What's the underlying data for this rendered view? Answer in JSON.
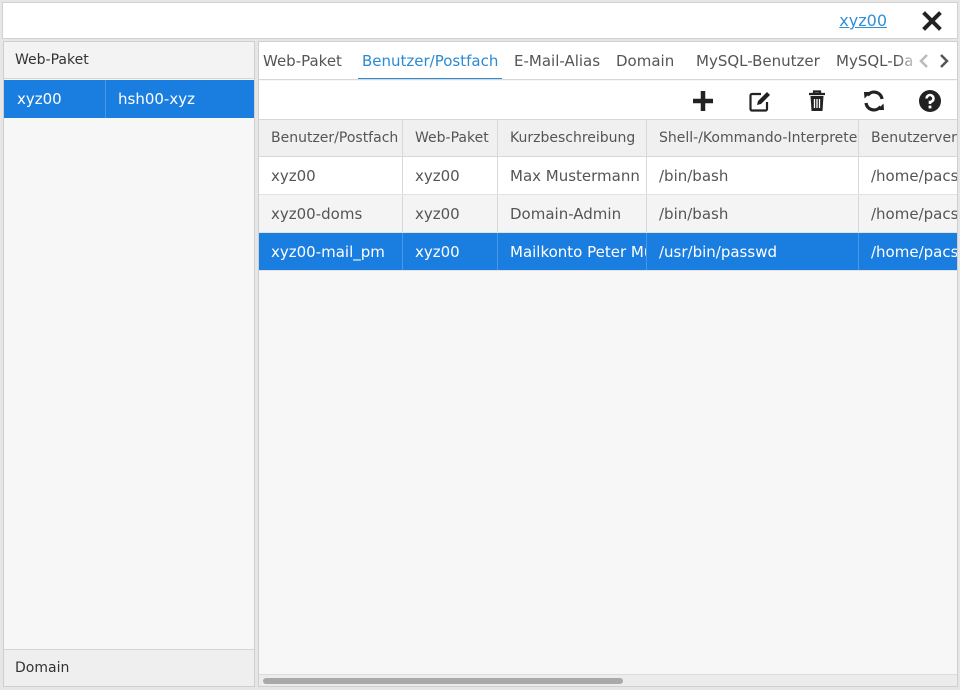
{
  "topbar": {
    "user_link": "xyz00",
    "close_icon": "close-icon"
  },
  "left_panel": {
    "header": "Web-Paket",
    "rows": [
      {
        "col1": "xyz00",
        "col2": "hsh00-xyz",
        "selected": true
      }
    ],
    "footer": "Domain"
  },
  "tabs": [
    {
      "label": "Web-Paket",
      "active": false
    },
    {
      "label": "Benutzer/Postfach",
      "active": true
    },
    {
      "label": "E-Mail-Alias",
      "active": false
    },
    {
      "label": "Domain",
      "active": false
    },
    {
      "label": "MySQL-Benutzer",
      "active": false
    },
    {
      "label": "MySQL-Da",
      "active": false
    }
  ],
  "tab_nav": {
    "prev_icon": "chevron-left-icon",
    "next_icon": "chevron-right-icon"
  },
  "toolbar": {
    "icons": [
      "plus-icon",
      "edit-icon",
      "trash-icon",
      "refresh-icon",
      "help-icon"
    ]
  },
  "grid": {
    "columns": [
      "Benutzer/Postfach",
      "Web-Paket",
      "Kurzbeschreibung",
      "Shell-/Kommando-Interpreter",
      "Benutzerverze"
    ],
    "rows": [
      {
        "cells": [
          "xyz00",
          "xyz00",
          "Max Mustermann",
          "/bin/bash",
          "/home/pacs/"
        ],
        "selected": false
      },
      {
        "cells": [
          "xyz00-doms",
          "xyz00",
          "Domain-Admin",
          "/bin/bash",
          "/home/pacs/"
        ],
        "selected": false
      },
      {
        "cells": [
          "xyz00-mail_pm",
          "xyz00",
          "Mailkonto Peter Mu",
          "/usr/bin/passwd",
          "/home/pacs/"
        ],
        "selected": true
      }
    ]
  },
  "colors": {
    "accent": "#1a7de0",
    "link": "#3090d8",
    "active_tab": "#2a8ad4"
  }
}
